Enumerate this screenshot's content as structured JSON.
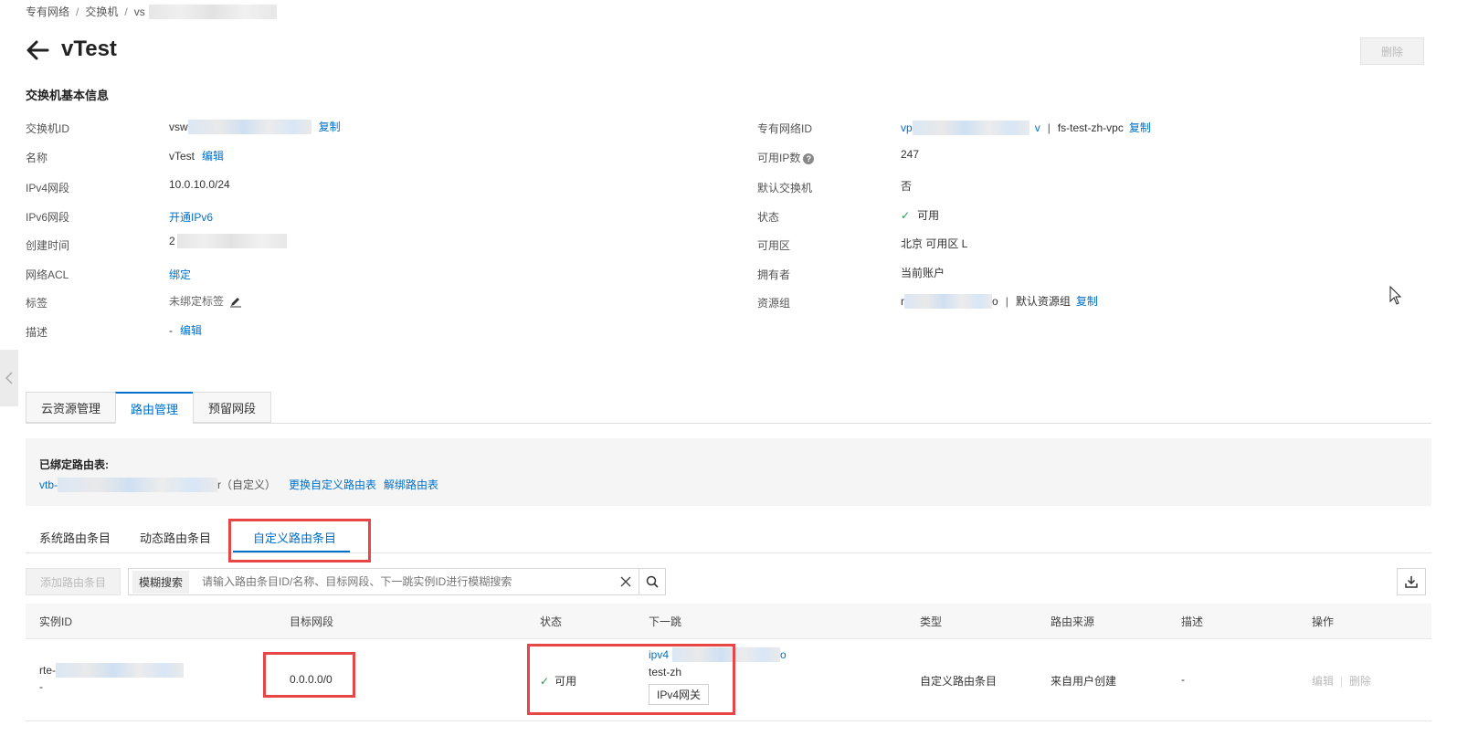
{
  "breadcrumb": {
    "item1": "专有网络",
    "item2": "交换机",
    "item3_prefix": "vs"
  },
  "header": {
    "title": "vTest",
    "delete_label": "删除"
  },
  "basic_info": {
    "section_title": "交换机基本信息",
    "left": {
      "vswitch_id_label": "交换机ID",
      "vswitch_id_prefix": "vsw",
      "copy_label": "复制",
      "name_label": "名称",
      "name_value": "vTest",
      "edit_label": "编辑",
      "ipv4_label": "IPv4网段",
      "ipv4_value": "10.0.10.0/24",
      "ipv6_label": "IPv6网段",
      "ipv6_action": "开通IPv6",
      "created_label": "创建时间",
      "created_prefix": "2",
      "acl_label": "网络ACL",
      "acl_action": "绑定",
      "tags_label": "标签",
      "tags_value": "未绑定标签",
      "desc_label": "描述",
      "desc_value": "-",
      "desc_edit": "编辑"
    },
    "right": {
      "vpc_id_label": "专有网络ID",
      "vpc_id_prefix": "vp",
      "vpc_id_suffix": "v",
      "vpc_name": "fs-test-zh-vpc",
      "copy_label": "复制",
      "available_ip_label": "可用IP数",
      "available_ip_value": "247",
      "default_label": "默认交换机",
      "default_value": "否",
      "status_label": "状态",
      "status_value": "可用",
      "zone_label": "可用区",
      "zone_value": "北京 可用区 L",
      "owner_label": "拥有者",
      "owner_value": "当前账户",
      "rg_label": "资源组",
      "rg_prefix": "r",
      "rg_suffix": "o",
      "rg_name": "默认资源组",
      "copy_label2": "复制"
    }
  },
  "tabs": [
    "云资源管理",
    "路由管理",
    "预留网段"
  ],
  "bound_route": {
    "title": "已绑定路由表:",
    "table_prefix": "vtb-",
    "table_suffix": "r（自定义）",
    "change_action": "更换自定义路由表",
    "unbind_action": "解绑路由表"
  },
  "sub_tabs": [
    "系统路由条目",
    "动态路由条目",
    "自定义路由条目"
  ],
  "toolbar": {
    "add_label": "添加路由条目",
    "search_type": "模糊搜索",
    "search_placeholder": "请输入路由条目ID/名称、目标网段、下一跳实例ID进行模糊搜索"
  },
  "table": {
    "columns": [
      "实例ID",
      "目标网段",
      "状态",
      "下一跳",
      "类型",
      "路由来源",
      "描述",
      "操作"
    ],
    "rows": [
      {
        "id_prefix": "rte-",
        "name": "-",
        "destination": "0.0.0.0/0",
        "status": "可用",
        "next_hop_prefix": "ipv4",
        "next_hop_suffix": "o",
        "next_hop_name": "test-zh",
        "next_hop_type": "IPv4网关",
        "type": "自定义路由条目",
        "source": "来自用户创建",
        "description": "-",
        "edit": "编辑",
        "delete": "删除"
      }
    ]
  },
  "colors": {
    "link": "#0070cc",
    "success": "#1e9e45",
    "highlight": "#e84646"
  }
}
